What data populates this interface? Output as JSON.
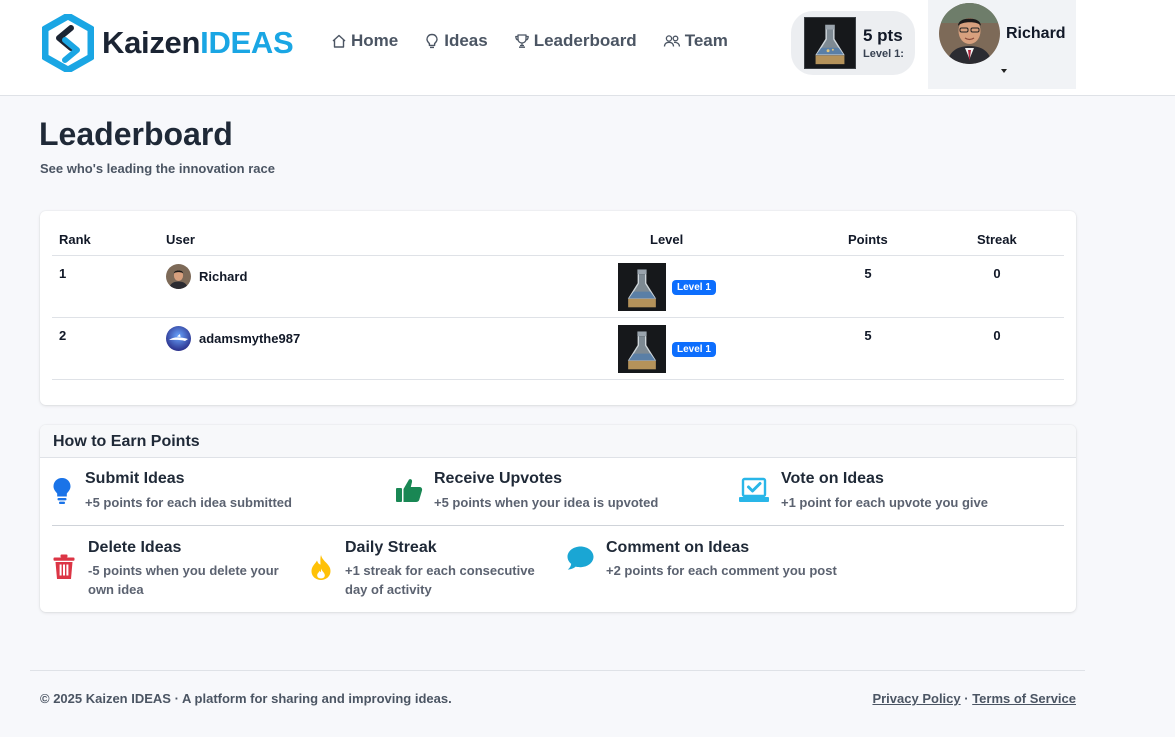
{
  "brand": {
    "name_part1": "Kaizen",
    "name_part2": "IDEAS"
  },
  "nav": [
    {
      "label": "Home",
      "icon": "home-icon"
    },
    {
      "label": "Ideas",
      "icon": "lightbulb-icon"
    },
    {
      "label": "Leaderboard",
      "icon": "trophy-icon"
    },
    {
      "label": "Team",
      "icon": "team-icon"
    }
  ],
  "points_chip": {
    "points": "5 pts",
    "level": "Level 1:"
  },
  "user": {
    "name": "Richard"
  },
  "page": {
    "title": "Leaderboard",
    "subtitle": "See who's leading the innovation race"
  },
  "leaderboard": {
    "columns": {
      "rank": "Rank",
      "user": "User",
      "level": "Level",
      "points": "Points",
      "streak": "Streak"
    },
    "rows": [
      {
        "rank": "1",
        "user": "Richard",
        "level": "Level 1",
        "points": "5",
        "streak": "0"
      },
      {
        "rank": "2",
        "user": "adamsmythe987",
        "level": "Level 1",
        "points": "5",
        "streak": "0"
      }
    ]
  },
  "earn": {
    "title": "How to Earn Points",
    "items": [
      {
        "name": "Submit Ideas",
        "desc": "+5 points for each idea submitted",
        "icon": "lightbulb-icon"
      },
      {
        "name": "Receive Upvotes",
        "desc": "+5 points when your idea is upvoted",
        "icon": "thumbs-up-icon"
      },
      {
        "name": "Vote on Ideas",
        "desc": "+1 point for each upvote you give",
        "icon": "ballot-check-icon"
      },
      {
        "name": "Delete Ideas",
        "desc": "-5 points when you delete your own idea",
        "icon": "trash-icon"
      },
      {
        "name": "Daily Streak",
        "desc": "+1 streak for each consecutive day of activity",
        "icon": "flame-icon"
      },
      {
        "name": "Comment on Ideas",
        "desc": "+2 points for each comment you post",
        "icon": "comment-icon"
      }
    ]
  },
  "footer": {
    "copyright": "© 2025 Kaizen IDEAS · A platform for sharing and improving ideas.",
    "privacy": "Privacy Policy",
    "separator": " · ",
    "terms": "Terms of Service"
  },
  "colors": {
    "brand_blue": "#1aa6e4",
    "brand_dark": "#1b2433",
    "level_pill": "#0d6efd",
    "icon_submit": "#1a73e8",
    "icon_upvote": "#198754",
    "icon_vote": "#29b6e8",
    "icon_delete": "#dc3545",
    "icon_streak": "#ffc107",
    "icon_comment": "#1aa6d4"
  }
}
